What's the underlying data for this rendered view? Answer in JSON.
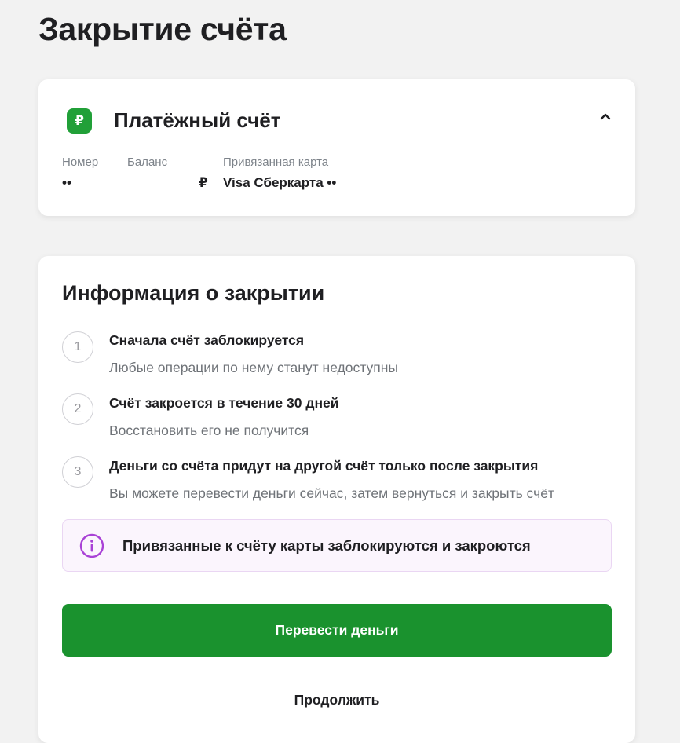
{
  "page": {
    "title": "Закрытие счёта"
  },
  "account": {
    "icon": "ruble-icon",
    "icon_symbol": "₽",
    "title": "Платёжный счёт",
    "number_label": "Номер",
    "number_value": "••",
    "balance_label": "Баланс",
    "balance_value": "₽",
    "card_label": "Привязанная карта",
    "card_value": "Visa Сберкарта ••",
    "accent_color": "#21a038"
  },
  "closing_info": {
    "title": "Информация о закрытии",
    "steps": [
      {
        "number": "1",
        "title": "Сначала счёт заблокируется",
        "subtitle": "Любые операции по нему станут недоступны"
      },
      {
        "number": "2",
        "title": "Счёт закроется в течение 30 дней",
        "subtitle": "Восстановить его не получится"
      },
      {
        "number": "3",
        "title": "Деньги со счёта придут на другой счёт только после закрытия",
        "subtitle": "Вы можете перевести деньги сейчас, затем вернуться и закрыть счёт"
      }
    ],
    "notice": {
      "icon": "info-icon",
      "text": "Привязанные к счёту карты заблокируются и закроются",
      "accent_color": "#a942d6"
    }
  },
  "actions": {
    "transfer_label": "Перевести деньги",
    "continue_label": "Продолжить",
    "primary_color": "#1a922e"
  }
}
